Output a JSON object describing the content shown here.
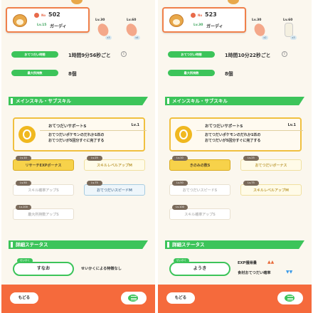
{
  "left": {
    "pokemon": {
      "no_label": "No",
      "number": "502",
      "level": "Lv.15",
      "name": "ガーディ"
    },
    "items": [
      {
        "level": "Lv.30",
        "count": "x3",
        "color": "#f4a88a"
      },
      {
        "level": "Lv.60",
        "count": "x4",
        "color": "#f4a88a"
      }
    ],
    "stats": [
      {
        "label": "おてつだい時間",
        "value": "1時間9分56秒ごと",
        "has_info": true
      },
      {
        "label": "最大所持数",
        "value": "8個",
        "has_info": false
      }
    ],
    "skill_section": "メインスキル・サブスキル",
    "skill": {
      "name": "おてつだいサポートS",
      "lv": "Lv.1",
      "desc": "おてつだいポケモンのだれか1匹の\nおてつだいが5回分すぐに完了する"
    },
    "subskills": [
      {
        "tag": "Lv.10",
        "label": "リサーチEXPボーナス",
        "style": "active"
      },
      {
        "tag": "Lv.25",
        "label": "スキルレベルアップM",
        "style": "half"
      },
      {
        "tag": "Lv.50",
        "label": "スキル確率アップS",
        "style": "inactive"
      },
      {
        "tag": "Lv.75",
        "label": "おてつだいスピードM",
        "style": "blue"
      },
      {
        "tag": "Lv.100",
        "label": "最大所持数アップS",
        "style": "inactive"
      }
    ],
    "detail_section": "詳細ステータス",
    "nature": {
      "tag": "せいかく",
      "value": "すなお",
      "effect": "せいかくによる特徴なし"
    },
    "back": "もどる"
  },
  "right": {
    "pokemon": {
      "no_label": "No",
      "number": "523",
      "level": "Lv.30",
      "name": "ガーディ"
    },
    "items": [
      {
        "level": "Lv.30",
        "count": "x2",
        "color": "#f4a88a"
      },
      {
        "level": "Lv.60",
        "count": "x3",
        "color": "#f0f0e0"
      }
    ],
    "stats": [
      {
        "label": "おてつだい時間",
        "value": "1時間10分22秒ごと",
        "has_info": true
      },
      {
        "label": "最大所持数",
        "value": "8個",
        "has_info": false
      }
    ],
    "skill_section": "メインスキル・サブスキル",
    "skill": {
      "name": "おてつだいサポートS",
      "lv": "Lv.1",
      "desc": "おてつだいポケモンのだれか1匹の\nおてつだいが5回分すぐに完了する"
    },
    "subskills": [
      {
        "tag": "Lv.10",
        "label": "きのみの数S",
        "style": "active"
      },
      {
        "tag": "Lv.25",
        "label": "おてつだいボーナス",
        "style": "half"
      },
      {
        "tag": "Lv.50",
        "label": "おてつだいスピードS",
        "style": "inactive"
      },
      {
        "tag": "Lv.75",
        "label": "スキルレベルアップM",
        "style": "half"
      },
      {
        "tag": "Lv.100",
        "label": "スキル確率アップS",
        "style": "inactive"
      }
    ],
    "detail_section": "詳細ステータス",
    "nature": {
      "tag": "せいかく",
      "value": "ようき",
      "up_label": "EXP獲得量",
      "up_arrows": "▲▲",
      "down_label": "食材おてつだい確率",
      "down_arrows": "▼▼"
    },
    "back": "もどる"
  }
}
